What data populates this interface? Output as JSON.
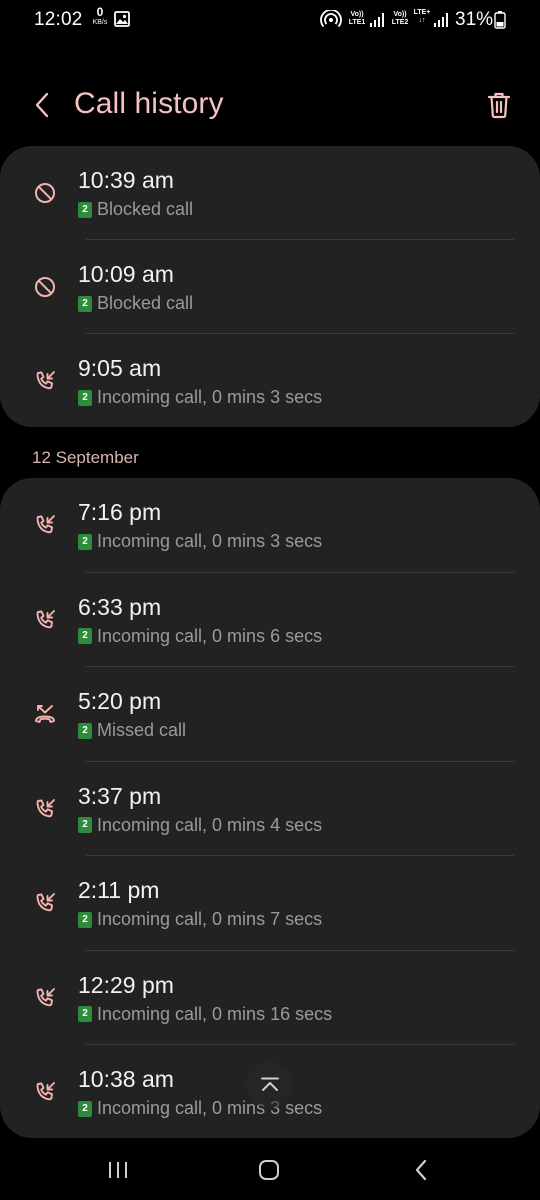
{
  "status_bar": {
    "time": "12:02",
    "net_speed_value": "0",
    "net_speed_unit": "KB/s",
    "volte1_line1": "Vo))",
    "volte1_line2": "LTE1",
    "volte2_line1": "Vo))",
    "volte2_line2": "LTE2",
    "lte_label": "LTE+",
    "lte_arrows": "↓↑",
    "battery": "31%"
  },
  "header": {
    "title": "Call history"
  },
  "groups": [
    {
      "label": "",
      "calls": [
        {
          "time": "10:39 am",
          "sim": "2",
          "desc": "Blocked call",
          "type": "blocked"
        },
        {
          "time": "10:09 am",
          "sim": "2",
          "desc": "Blocked call",
          "type": "blocked"
        },
        {
          "time": "9:05 am",
          "sim": "2",
          "desc": "Incoming call, 0 mins 3 secs",
          "type": "incoming"
        }
      ]
    },
    {
      "label": "12 September",
      "calls": [
        {
          "time": "7:16 pm",
          "sim": "2",
          "desc": "Incoming call, 0 mins 3 secs",
          "type": "incoming"
        },
        {
          "time": "6:33 pm",
          "sim": "2",
          "desc": "Incoming call, 0 mins 6 secs",
          "type": "incoming"
        },
        {
          "time": "5:20 pm",
          "sim": "2",
          "desc": "Missed call",
          "type": "missed"
        },
        {
          "time": "3:37 pm",
          "sim": "2",
          "desc": "Incoming call, 0 mins 4 secs",
          "type": "incoming"
        },
        {
          "time": "2:11 pm",
          "sim": "2",
          "desc": "Incoming call, 0 mins 7 secs",
          "type": "incoming"
        },
        {
          "time": "12:29 pm",
          "sim": "2",
          "desc": "Incoming call, 0 mins 16 secs",
          "type": "incoming"
        },
        {
          "time": "10:38 am",
          "sim": "2",
          "desc": "Incoming call, 0 mins 3 secs",
          "type": "incoming"
        }
      ]
    }
  ],
  "colors": {
    "accent": "#f4c3c0",
    "icon": "#f3b3ae",
    "sim_badge": "#2e8b3c",
    "card": "#222222",
    "background": "#000000"
  },
  "icons": {
    "back": "chevron-left-icon",
    "delete": "trash-icon",
    "blocked": "block-icon",
    "incoming": "incoming-call-icon",
    "missed": "missed-call-icon",
    "scroll_top": "chevron-up-icon"
  }
}
